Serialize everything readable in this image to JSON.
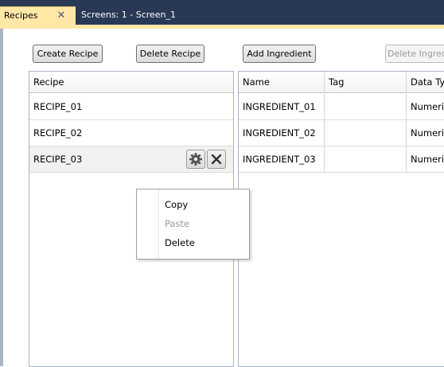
{
  "tabs": [
    {
      "label": "Recipes",
      "close": "✕"
    },
    {
      "label": "Screens: 1 - Screen_1"
    }
  ],
  "toolbar": {
    "create_recipe": "Create Recipe",
    "delete_recipe": "Delete Recipe",
    "add_ingredient": "Add Ingredient",
    "delete_ingredient": "Delete Ingredient"
  },
  "recipes": {
    "header": "Recipe",
    "rows": [
      "RECIPE_01",
      "RECIPE_02",
      "RECIPE_03"
    ],
    "selected_row_icons": [
      "gear-icon",
      "close-icon"
    ]
  },
  "ingredients": {
    "headers": [
      "Name",
      "Tag",
      "Data Type"
    ],
    "rows": [
      [
        "INGREDIENT_01",
        "",
        "Numeric"
      ],
      [
        "INGREDIENT_02",
        "",
        "Numeric"
      ],
      [
        "INGREDIENT_03",
        "",
        "Numeric"
      ]
    ]
  },
  "context_menu": {
    "items": [
      {
        "label": "Copy",
        "enabled": true
      },
      {
        "label": "Paste",
        "enabled": false
      },
      {
        "label": "Delete",
        "enabled": true
      }
    ]
  },
  "colors": {
    "titlebar": "#293955",
    "active_tab": "#ffe8a6",
    "selected_row": "#f1f1f1"
  }
}
